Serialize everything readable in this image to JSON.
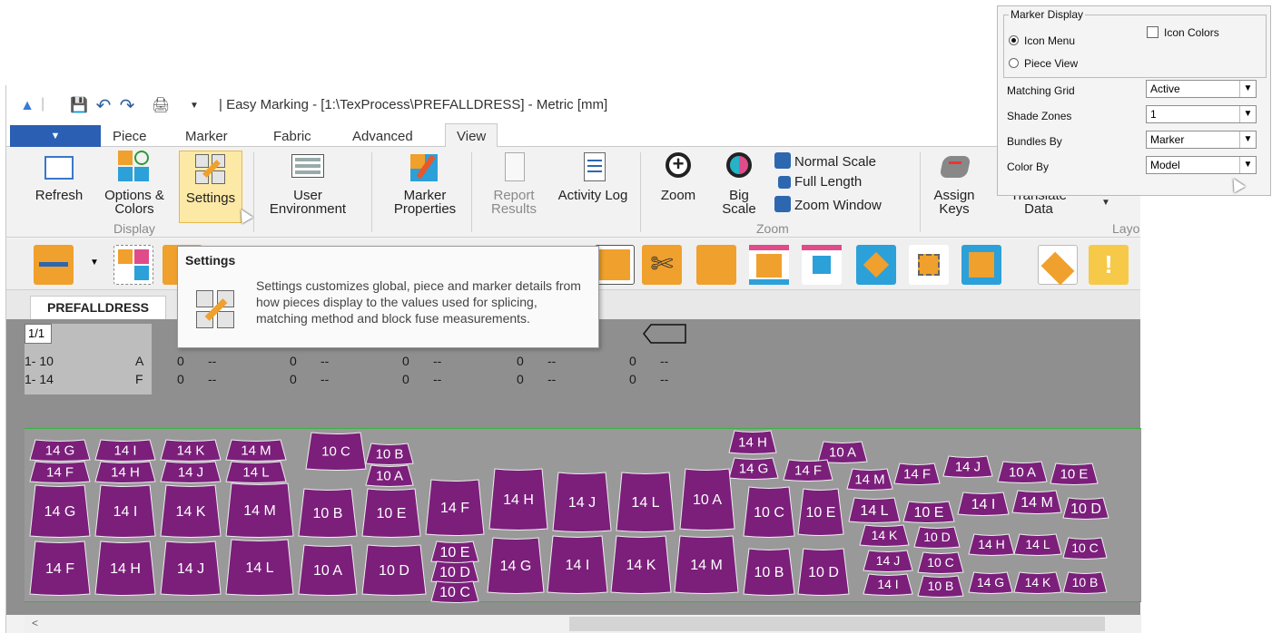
{
  "window": {
    "title": "| Easy Marking - [1:\\TexProcess\\PREFALLDRESS] - Metric [mm]"
  },
  "ribbon_tabs": [
    "Piece",
    "Marker",
    "Fabric",
    "Advanced",
    "View"
  ],
  "ribbon_active_tab": "View",
  "display_group": {
    "label": "Display",
    "buttons": [
      {
        "label": "Refresh"
      },
      {
        "label": "Options & Colors"
      },
      {
        "label": "Settings"
      }
    ]
  },
  "more_buttons": [
    {
      "label": "User Environment"
    },
    {
      "label": "Marker Properties"
    },
    {
      "label": "Report Results"
    },
    {
      "label": "Activity Log"
    }
  ],
  "zoom_group": {
    "label": "Zoom",
    "buttons": [
      {
        "label": "Zoom"
      },
      {
        "label": "Big Scale"
      }
    ],
    "small_buttons": [
      "Normal Scale",
      "Full Length",
      "Zoom Window"
    ]
  },
  "assign_keys": {
    "label": "Assign Keys"
  },
  "translate": {
    "label": "Translate Data"
  },
  "layout_label": "Layo",
  "tooltip": {
    "title": "Settings",
    "text": "Settings customizes global, piece and marker details from how pieces display to the values used for splicing, matching method and block fuse measurements."
  },
  "doc_tab": "PREFALLDRESS",
  "marker_info": {
    "page": "1/1",
    "rows": [
      {
        "range": "1- 10",
        "bundle": "A",
        "c1": "0",
        "d1": "--",
        "c2": "0",
        "d2": "--",
        "c3": "0",
        "d3": "--",
        "c4": "0",
        "d4": "--",
        "c5": "0",
        "d5": "--"
      },
      {
        "range": "1- 14",
        "bundle": "F",
        "c1": "0",
        "d1": "--",
        "c2": "0",
        "d2": "--",
        "c3": "0",
        "d3": "--",
        "c4": "0",
        "d4": "--",
        "c5": "0",
        "d5": "--"
      }
    ]
  },
  "pieces": {
    "color": "#7b1f7b",
    "row1": [
      "14 G",
      "14 I",
      "14 K",
      "14 M",
      "10 C",
      "10 B",
      "14 H",
      "10 A"
    ],
    "row1b": [
      "14 F",
      "14 H",
      "14 J",
      "14 L",
      "10 A",
      "14 G",
      "14 F",
      "14 M",
      "14 F",
      "14 J",
      "10 A",
      "10 E"
    ],
    "row2": [
      "14 G",
      "14 I",
      "14 K",
      "14 M",
      "10 B",
      "10 E",
      "14 F",
      "14 H",
      "14 J",
      "14 L",
      "10 A",
      "10 C",
      "10 E",
      "14 L",
      "10 E",
      "14 I",
      "14 M",
      "10 D"
    ],
    "row3": [
      "14 F",
      "14 H",
      "14 J",
      "14 L",
      "10 A",
      "10 D",
      "10 E",
      "10 D",
      "10 C",
      "14 G",
      "14 I",
      "14 K",
      "14 M",
      "10 B",
      "10 D",
      "14 K",
      "10 D",
      "14 H",
      "14 L",
      "10 C",
      "14 J",
      "10 C",
      "14 I",
      "10 B",
      "14 G",
      "14 K",
      "10 B"
    ]
  },
  "marker_display_panel": {
    "group_label": "Marker Display",
    "radio_icon_menu": "Icon Menu",
    "radio_piece_view": "Piece View",
    "icon_colors_label": "Icon Colors",
    "rows": [
      {
        "label": "Matching Grid",
        "value": "Active"
      },
      {
        "label": "Shade Zones",
        "value": "1"
      },
      {
        "label": "Bundles By",
        "value": "Marker"
      },
      {
        "label": "Color By",
        "value": "Model"
      }
    ]
  },
  "scroll_left_glyph": "<"
}
